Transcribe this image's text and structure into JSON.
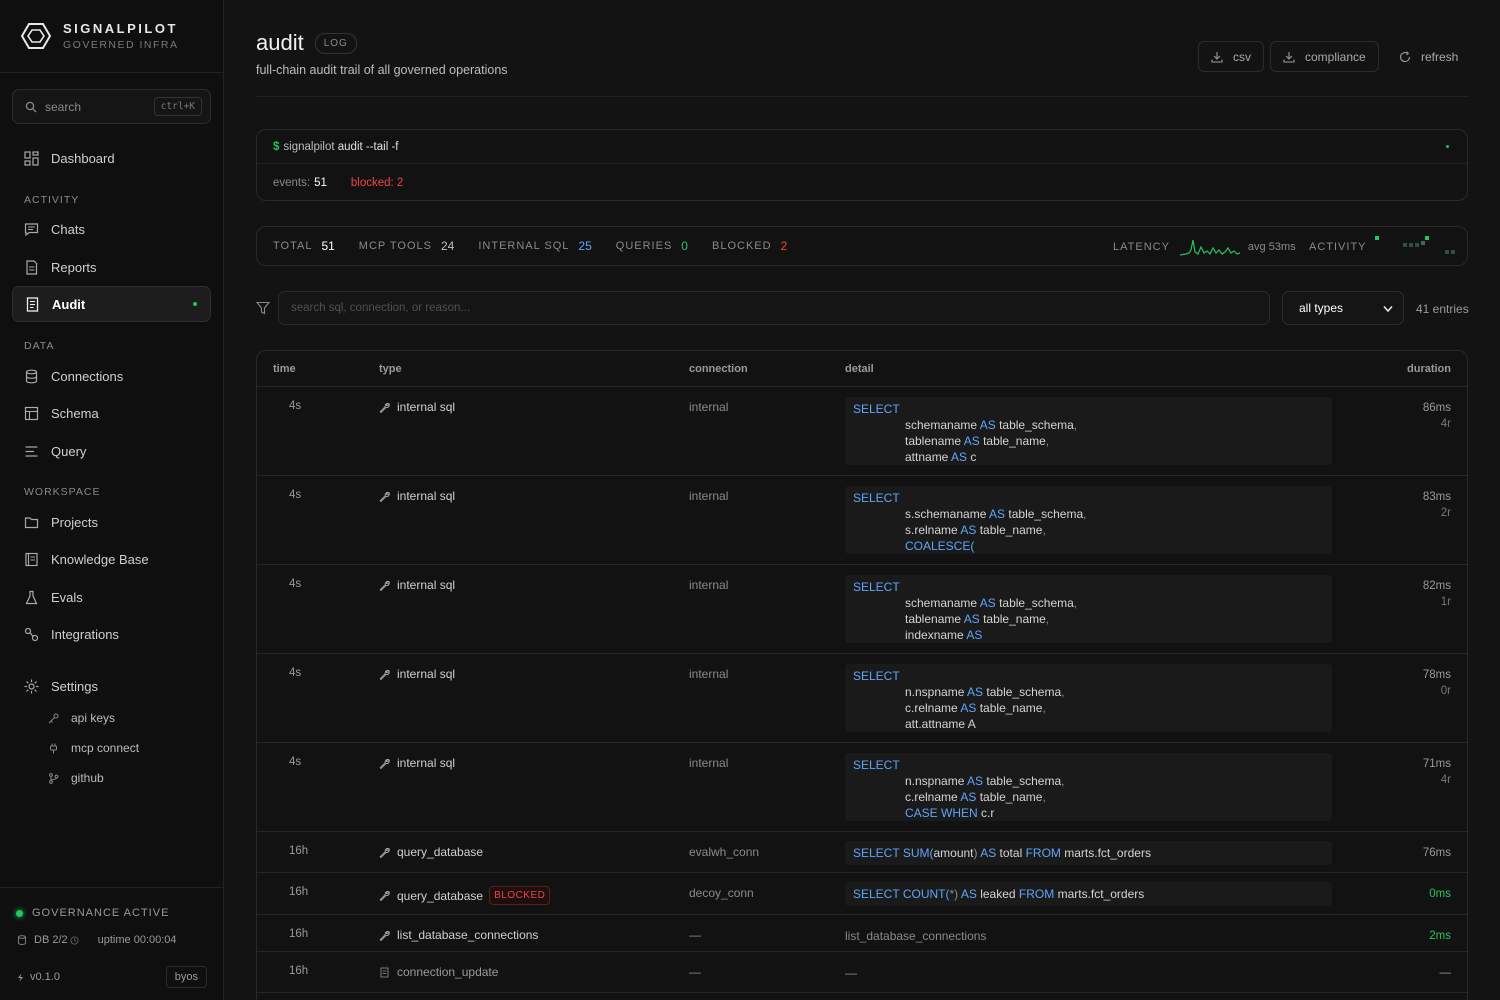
{
  "brand": {
    "name": "SIGNALPILOT",
    "subtitle": "GOVERNED INFRA"
  },
  "search": {
    "placeholder": "search",
    "shortcut": "ctrl+K"
  },
  "nav": {
    "dashboard": "Dashboard",
    "activity_label": "ACTIVITY",
    "chats": "Chats",
    "reports": "Reports",
    "audit": "Audit",
    "data_label": "DATA",
    "connections": "Connections",
    "schema": "Schema",
    "query": "Query",
    "workspace_label": "WORKSPACE",
    "projects": "Projects",
    "knowledge_base": "Knowledge Base",
    "evals": "Evals",
    "integrations": "Integrations",
    "settings": "Settings",
    "api_keys": "api keys",
    "mcp_connect": "mcp connect",
    "github": "github"
  },
  "footer": {
    "governance": "GOVERNANCE ACTIVE",
    "db": "DB 2/2",
    "uptime": "uptime 00:00:04",
    "version": "v0.1.0",
    "byos": "byos"
  },
  "header": {
    "title": "audit",
    "badge": "LOG",
    "subtitle": "full-chain audit trail of all governed operations",
    "csv": "csv",
    "compliance": "compliance",
    "refresh": "refresh"
  },
  "terminal": {
    "prompt": "$",
    "cmd_prefix": "signalpilot",
    "cmd_main": "audit --tail -f",
    "events_label": "events:",
    "events_value": "51",
    "blocked": "blocked: 2"
  },
  "stats": {
    "total_label": "TOTAL",
    "total": "51",
    "mcp_label": "MCP TOOLS",
    "mcp": "24",
    "internal_label": "INTERNAL SQL",
    "internal": "25",
    "queries_label": "QUERIES",
    "queries": "0",
    "blocked_label": "BLOCKED",
    "blocked": "2",
    "latency_label": "LATENCY",
    "latency_avg": "avg 53ms",
    "activity_label": "ACTIVITY"
  },
  "filter": {
    "placeholder": "search sql, connection, or reason...",
    "type_selected": "all types",
    "entries": "41 entries"
  },
  "columns": {
    "time": "time",
    "type": "type",
    "connection": "connection",
    "detail": "detail",
    "duration": "duration"
  },
  "rows": [
    {
      "time": "4s",
      "type": "internal sql",
      "connection": "internal",
      "sql": [
        "SELECT",
        "schemaname AS table_schema,",
        "tablename AS table_name,",
        "attname AS c"
      ],
      "duration": "86ms",
      "rows": "4r"
    },
    {
      "time": "4s",
      "type": "internal sql",
      "connection": "internal",
      "sql": [
        "SELECT",
        "s.schemaname AS table_schema,",
        "s.relname AS table_name,",
        "COALESCE("
      ],
      "duration": "83ms",
      "rows": "2r"
    },
    {
      "time": "4s",
      "type": "internal sql",
      "connection": "internal",
      "sql": [
        "SELECT",
        "schemaname AS table_schema,",
        "tablename AS table_name,",
        "indexname AS"
      ],
      "duration": "82ms",
      "rows": "1r"
    },
    {
      "time": "4s",
      "type": "internal sql",
      "connection": "internal",
      "sql": [
        "SELECT",
        "n.nspname AS table_schema,",
        "c.relname AS table_name,",
        "att.attname A"
      ],
      "duration": "78ms",
      "rows": "0r"
    },
    {
      "time": "4s",
      "type": "internal sql",
      "connection": "internal",
      "sql": [
        "SELECT",
        "n.nspname AS table_schema,",
        "c.relname AS table_name,",
        "CASE WHEN c.r"
      ],
      "duration": "71ms",
      "rows": "4r"
    },
    {
      "time": "16h",
      "type": "query_database",
      "connection": "evalwh_conn",
      "sql_inline": "SELECT SUM(amount) AS total FROM marts.fct_orders",
      "duration": "76ms"
    },
    {
      "time": "16h",
      "type": "query_database",
      "badge": "BLOCKED",
      "connection": "decoy_conn",
      "sql_inline": "SELECT COUNT(*) AS leaked FROM marts.fct_orders",
      "duration": "0ms"
    },
    {
      "time": "16h",
      "type": "list_database_connections",
      "connection": "—",
      "detail": "list_database_connections",
      "duration": "2ms"
    },
    {
      "time": "16h",
      "type": "connection_update",
      "connection": "—",
      "detail": "—",
      "duration": "—"
    }
  ],
  "colors": {
    "accent_green": "#22c55e",
    "keyword_blue": "#60a5fa",
    "danger_red": "#ef4444"
  }
}
